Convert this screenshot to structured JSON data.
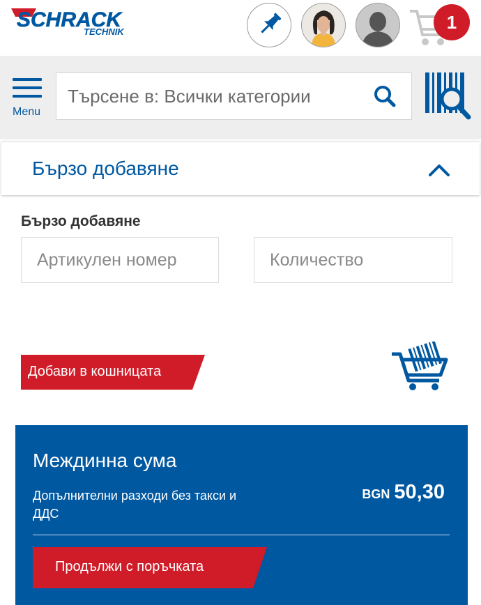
{
  "header": {
    "logo_main": "SCHRACK",
    "logo_sub": "TECHNIK",
    "cart_count": "1",
    "icons": [
      "pin-icon",
      "user-avatar",
      "user-placeholder-icon",
      "cart-icon"
    ]
  },
  "search": {
    "menu_label": "Menu",
    "placeholder": "Търсене в: Всички категории",
    "icons": [
      "hamburger-icon",
      "search-icon",
      "barcode-scan-icon"
    ]
  },
  "accordion": {
    "title": "Бързо добавяне",
    "icon": "chevron-up-icon"
  },
  "quick_add": {
    "label": "Бързо добавяне",
    "article_placeholder": "Артикулен номер",
    "quantity_placeholder": "Количество",
    "add_button": "Добави в кошницата",
    "icon": "barcode-cart-icon"
  },
  "subtotal": {
    "title": "Междинна сума",
    "note": "Допълнителни разходи без такси и ДДС",
    "currency": "BGN",
    "amount": "50,30",
    "continue_button": "Продължи с поръчката"
  },
  "colors": {
    "brand_blue": "#0058a1",
    "accent_red": "#d01c28",
    "bar_gray": "#eeeeee"
  }
}
